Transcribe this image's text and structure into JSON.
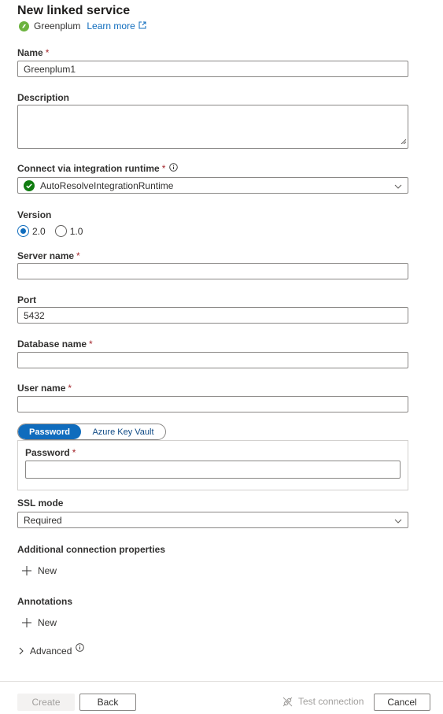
{
  "header": {
    "title": "New linked service",
    "connector_name": "Greenplum",
    "learn_more": "Learn more"
  },
  "form": {
    "name_label": "Name",
    "name_value": "Greenplum1",
    "description_label": "Description",
    "description_value": "",
    "runtime_label": "Connect via integration runtime",
    "runtime_value": "AutoResolveIntegrationRuntime",
    "version_label": "Version",
    "version_options": [
      "2.0",
      "1.0"
    ],
    "version_selected": "2.0",
    "server_label": "Server name",
    "server_value": "",
    "port_label": "Port",
    "port_value": "5432",
    "database_label": "Database name",
    "database_value": "",
    "user_label": "User name",
    "user_value": "",
    "auth_tabs": [
      "Password",
      "Azure Key Vault"
    ],
    "auth_selected": "Password",
    "password_label": "Password",
    "password_value": "",
    "ssl_label": "SSL mode",
    "ssl_value": "Required",
    "additional_label": "Additional connection properties",
    "additional_new": "New",
    "annotations_label": "Annotations",
    "annotations_new": "New",
    "advanced_label": "Advanced"
  },
  "footer": {
    "create": "Create",
    "back": "Back",
    "test_connection": "Test connection",
    "cancel": "Cancel"
  },
  "colors": {
    "accent": "#0f6cbd",
    "required": "#a4262c",
    "success": "#107c10",
    "greenplum": "#6cb33f"
  }
}
